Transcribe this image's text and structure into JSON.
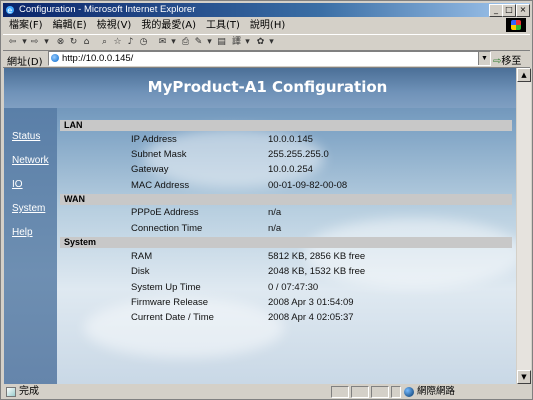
{
  "window": {
    "title": "Configuration - Microsoft Internet Explorer"
  },
  "menu": [
    "檔案(F)",
    "編輯(E)",
    "檢視(V)",
    "我的最愛(A)",
    "工具(T)",
    "說明(H)"
  ],
  "address": {
    "label": "網址(D)",
    "url": "http://10.0.0.145/",
    "go": "移至"
  },
  "page": {
    "title": "MyProduct-A1 Configuration"
  },
  "sidebar": [
    "Status",
    "Network",
    "IO",
    "System",
    "Help"
  ],
  "sections": {
    "lan": {
      "title": "LAN",
      "rows": [
        {
          "label": "IP Address",
          "value": "10.0.0.145"
        },
        {
          "label": "Subnet Mask",
          "value": "255.255.255.0"
        },
        {
          "label": "Gateway",
          "value": "10.0.0.254"
        },
        {
          "label": "MAC Address",
          "value": "00-01-09-82-00-08"
        }
      ]
    },
    "wan": {
      "title": "WAN",
      "rows": [
        {
          "label": "PPPoE Address",
          "value": "n/a"
        },
        {
          "label": "Connection Time",
          "value": "n/a"
        }
      ]
    },
    "system": {
      "title": "System",
      "rows": [
        {
          "label": "RAM",
          "value": "5812 KB, 2856 KB free"
        },
        {
          "label": "Disk",
          "value": "2048 KB, 1532 KB free"
        },
        {
          "label": "System Up Time",
          "value": "0 / 07:47:30"
        },
        {
          "label": "Firmware Release",
          "value": "2008 Apr 3 01:54:09"
        },
        {
          "label": "Current Date / Time",
          "value": "2008 Apr 4 02:05:37"
        }
      ]
    }
  },
  "status": {
    "text": "完成",
    "zone": "網際網路"
  }
}
